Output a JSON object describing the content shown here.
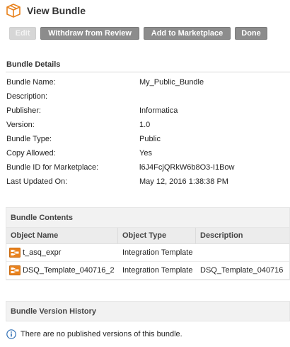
{
  "header": {
    "title": "View Bundle",
    "icon": "bundle-box-icon",
    "icon_color": "#e8821e"
  },
  "toolbar": {
    "edit_label": "Edit",
    "withdraw_label": "Withdraw from Review",
    "marketplace_label": "Add to Marketplace",
    "done_label": "Done"
  },
  "details": {
    "title": "Bundle Details",
    "rows": [
      {
        "label": "Bundle Name:",
        "value": "My_Public_Bundle"
      },
      {
        "label": "Description:",
        "value": ""
      },
      {
        "label": "Publisher:",
        "value": "Informatica"
      },
      {
        "label": "Version:",
        "value": "1.0"
      },
      {
        "label": "Bundle Type:",
        "value": "Public"
      },
      {
        "label": "Copy Allowed:",
        "value": "Yes"
      },
      {
        "label": "Bundle ID for Marketplace:",
        "value": "l6J4FcjQRkW6b8O3-I1Bow"
      },
      {
        "label": "Last Updated On:",
        "value": "May 12, 2016 1:38:38 PM"
      }
    ]
  },
  "contents": {
    "title": "Bundle Contents",
    "columns": [
      "Object Name",
      "Object Type",
      "Description"
    ],
    "rows": [
      {
        "name": "t_asq_expr",
        "type": "Integration Template",
        "description": ""
      },
      {
        "name": "DSQ_Template_040716_2",
        "type": "Integration Template",
        "description": "DSQ_Template_040716"
      }
    ]
  },
  "history": {
    "title": "Bundle Version History",
    "message": "There are no published versions of this bundle."
  }
}
